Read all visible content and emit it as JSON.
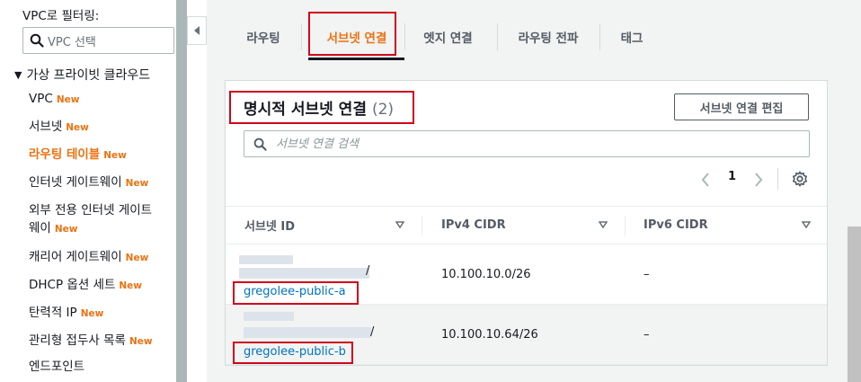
{
  "sidebar": {
    "filter_label": "VPC로 필터링:",
    "vpc_select_placeholder": "VPC 선택",
    "section_title": "가상 프라이빗 클라우드",
    "items": [
      {
        "label": "VPC",
        "badge": "New"
      },
      {
        "label": "서브넷",
        "badge": "New"
      },
      {
        "label": "라우팅 테이블",
        "badge": "New",
        "active": true
      },
      {
        "label": "인터넷 게이트웨이",
        "badge": "New"
      },
      {
        "label": "외부 전용 인터넷 게이트",
        "label2": "웨이",
        "badge": "New"
      },
      {
        "label": "캐리어 게이트웨이",
        "badge": "New"
      },
      {
        "label": "DHCP 옵션 세트",
        "badge": "New"
      },
      {
        "label": "탄력적 IP",
        "badge": "New"
      },
      {
        "label": "관리형 접두사 목록",
        "badge": "New"
      },
      {
        "label": "엔드포인트",
        "badge": ""
      }
    ]
  },
  "tabs": [
    {
      "label": "라우팅"
    },
    {
      "label": "서브넷 연결",
      "active": true
    },
    {
      "label": "엣지 연결"
    },
    {
      "label": "라우팅 전파"
    },
    {
      "label": "태그"
    }
  ],
  "panel": {
    "title": "명시적 서브넷 연결",
    "count": "(2)",
    "edit_button": "서브넷 연결 편집",
    "search_placeholder": "서브넷 연결 검색",
    "page": "1",
    "columns": [
      "서브넷 ID",
      "IPv4 CIDR",
      "IPv6 CIDR"
    ],
    "rows": [
      {
        "subnet_suffix": "/",
        "subnet_name": "gregolee-public-a",
        "ipv4": "10.100.10.0/26",
        "ipv6": "–"
      },
      {
        "subnet_suffix": "/",
        "subnet_name": "gregolee-public-b",
        "ipv4": "10.100.10.64/26",
        "ipv6": "–"
      }
    ]
  },
  "colors": {
    "accent": "#ec7211",
    "link": "#0073bb",
    "highlight": "#d0021b"
  }
}
